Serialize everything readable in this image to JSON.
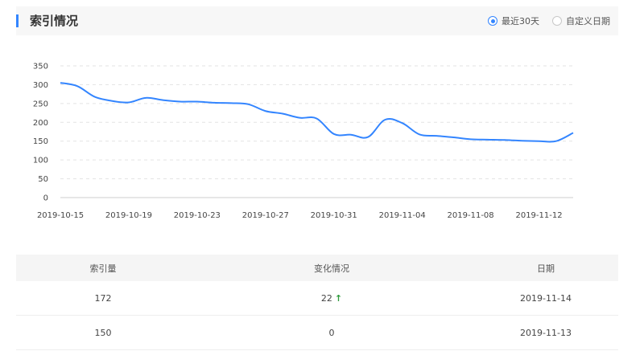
{
  "header": {
    "title": "索引情况",
    "options": [
      "最近30天",
      "自定义日期"
    ],
    "selected": "最近30天"
  },
  "colors": {
    "accent": "#3385ff",
    "up_arrow": "#2b9a3a",
    "header_bg": "#f7f7f7"
  },
  "chart_data": {
    "type": "line",
    "title": "",
    "xlabel": "",
    "ylabel": "",
    "ylim": [
      0,
      350
    ],
    "yticks": [
      "0",
      "50",
      "100",
      "150",
      "200",
      "250",
      "300",
      "350"
    ],
    "xticks": [
      "2019-10-15",
      "2019-10-19",
      "2019-10-23",
      "2019-10-27",
      "2019-10-31",
      "2019-11-04",
      "2019-11-08",
      "2019-11-12"
    ],
    "grid": true,
    "x": [
      "2019-10-15",
      "2019-10-16",
      "2019-10-17",
      "2019-10-18",
      "2019-10-19",
      "2019-10-20",
      "2019-10-21",
      "2019-10-22",
      "2019-10-23",
      "2019-10-24",
      "2019-10-25",
      "2019-10-26",
      "2019-10-27",
      "2019-10-28",
      "2019-10-29",
      "2019-10-30",
      "2019-10-31",
      "2019-11-01",
      "2019-11-02",
      "2019-11-03",
      "2019-11-04",
      "2019-11-05",
      "2019-11-06",
      "2019-11-07",
      "2019-11-08",
      "2019-11-09",
      "2019-11-10",
      "2019-11-11",
      "2019-11-12",
      "2019-11-13",
      "2019-11-14"
    ],
    "values": [
      305,
      296,
      268,
      257,
      253,
      265,
      259,
      255,
      255,
      252,
      251,
      248,
      230,
      223,
      212,
      210,
      169,
      167,
      161,
      207,
      198,
      168,
      164,
      160,
      155,
      154,
      153,
      151,
      150,
      150,
      172
    ]
  },
  "table": {
    "headers": [
      "索引量",
      "变化情况",
      "日期"
    ],
    "rows": [
      {
        "count": "172",
        "change": "22",
        "arrow": "↑",
        "date": "2019-11-14"
      },
      {
        "count": "150",
        "change": "0",
        "arrow": "",
        "date": "2019-11-13"
      }
    ]
  }
}
